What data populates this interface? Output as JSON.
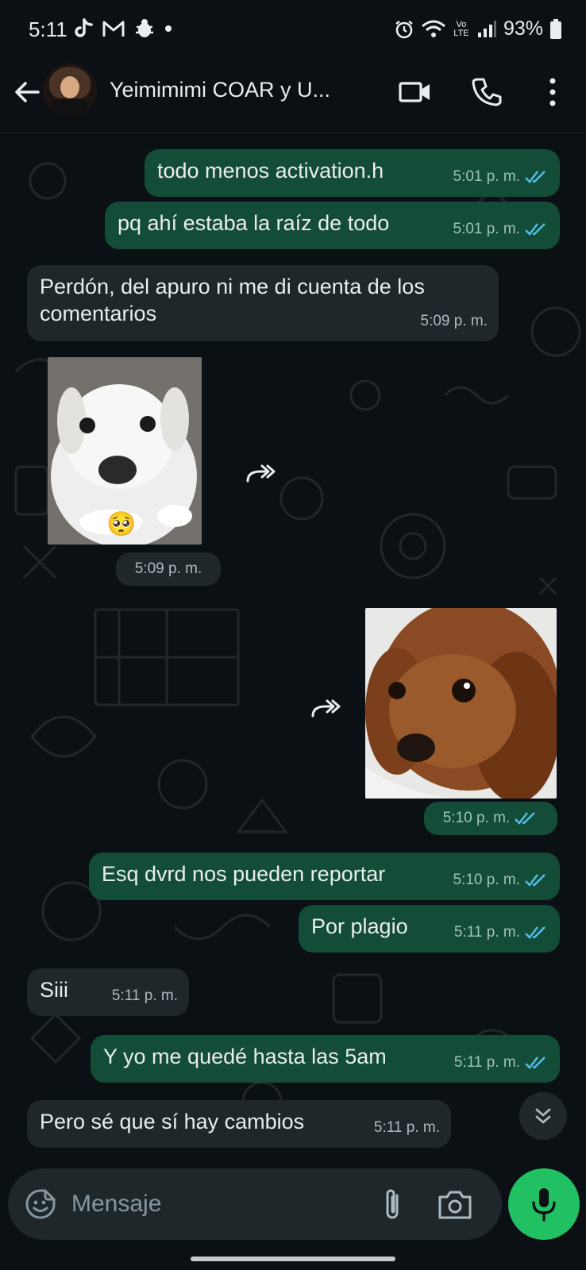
{
  "status_bar": {
    "time": "5:11",
    "battery": "93%",
    "left_icons": [
      "tiktok-icon",
      "gmail-icon",
      "bug-icon",
      "dot-icon"
    ],
    "right_icons": [
      "alarm-icon",
      "wifi-icon",
      "volte-icon",
      "signal-icon",
      "battery-icon"
    ],
    "volte_label": "Vo LTE"
  },
  "header": {
    "title": "Yeimimimi COAR y U...",
    "icons": [
      "back-arrow-icon",
      "video-call-icon",
      "phone-icon",
      "more-vert-icon"
    ]
  },
  "messages": [
    {
      "dir": "out",
      "text": "todo menos activation.h",
      "time": "5:01 p. m.",
      "read": true
    },
    {
      "dir": "out",
      "text": "pq ahí estaba la raíz de todo",
      "time": "5:01 p. m.",
      "read": true
    },
    {
      "dir": "in",
      "text": "Perdón, del apuro ni me di cuenta de los comentarios",
      "time": "5:09 p. m."
    },
    {
      "dir": "in",
      "type": "image",
      "image": "white-puppy-pleading-sticker",
      "emoji": "🥺",
      "time": "5:09 p. m."
    },
    {
      "dir": "out",
      "type": "image",
      "image": "brown-puppy-photo",
      "time": "5:10 p. m.",
      "read": true
    },
    {
      "dir": "out",
      "text": "Esq dvrd nos pueden reportar",
      "time": "5:10 p. m.",
      "read": true
    },
    {
      "dir": "out",
      "text": "Por plagio",
      "time": "5:11 p. m.",
      "read": true
    },
    {
      "dir": "in",
      "text": "Siii",
      "time": "5:11 p. m."
    },
    {
      "dir": "out",
      "text": "Y yo me quedé hasta las 5am",
      "time": "5:11 p. m.",
      "read": true
    },
    {
      "dir": "in",
      "text": "Pero sé que sí hay cambios",
      "time": "5:11 p. m."
    }
  ],
  "composer": {
    "placeholder": "Mensaje",
    "icons": [
      "emoji-icon",
      "attach-icon",
      "camera-icon",
      "mic-icon"
    ]
  },
  "colors": {
    "background": "#0b1014",
    "outgoing_bubble": "#144d37",
    "incoming_bubble": "#1f272a",
    "read_ticks": "#53bdeb",
    "mic_button": "#21c063"
  }
}
